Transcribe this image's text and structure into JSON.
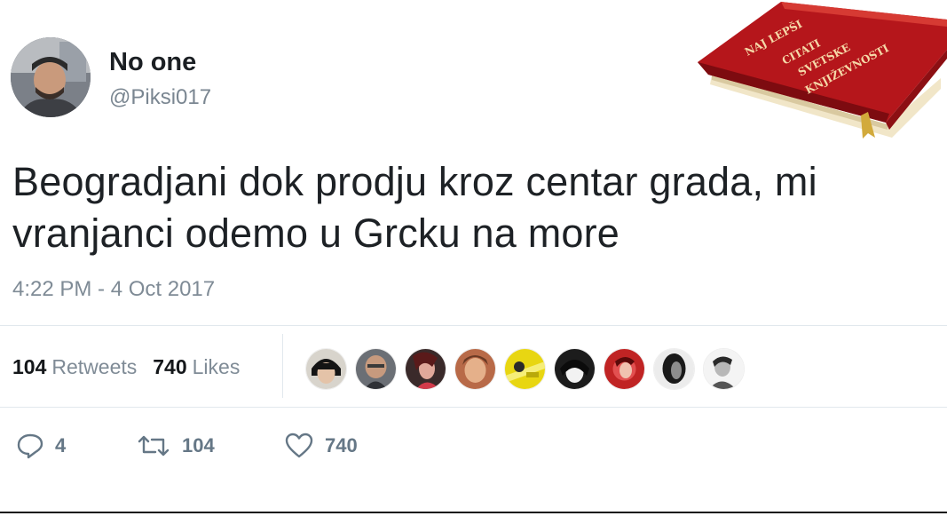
{
  "user": {
    "display_name": "No one",
    "handle": "@Piksi017"
  },
  "tweet": {
    "text": "Beogradjani dok prodju kroz centar grada, mi\nvranjanci odemo u Grcku na more",
    "timestamp": "4:22 PM - 4 Oct 2017"
  },
  "stats": {
    "retweets_count": "104",
    "retweets_label": "Retweets",
    "likes_count": "740",
    "likes_label": "Likes"
  },
  "actions": {
    "reply_count": "4",
    "retweet_count": "104",
    "like_count": "740"
  },
  "book_cover_text": "NAJ LEPŠI CITATI SVETSKE KNJIŽEVNOSTI",
  "colors": {
    "book_red": "#b5161b",
    "text_secondary": "#7f8b96",
    "divider": "#e1e8ed"
  }
}
